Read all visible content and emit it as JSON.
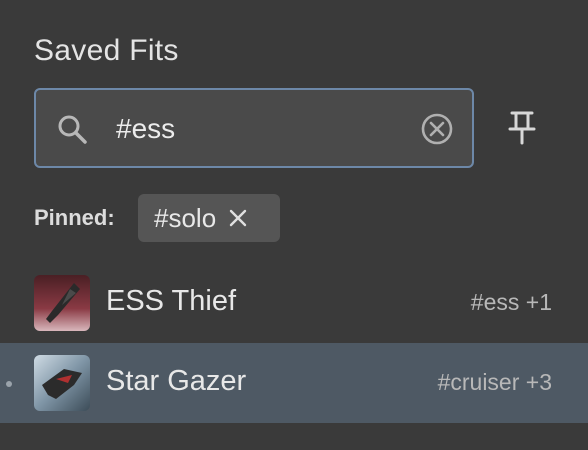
{
  "panel": {
    "title": "Saved Fits"
  },
  "search": {
    "value": "#ess",
    "icon": "search-icon",
    "clear_icon": "clear-circle-icon",
    "border_color": "#6d88a8"
  },
  "pin_button": {
    "icon": "pin-icon"
  },
  "pinned": {
    "label": "Pinned:",
    "chips": [
      {
        "label": "#solo",
        "icon": "close-icon"
      }
    ]
  },
  "fits": [
    {
      "name": "ESS Thief",
      "tags": "#ess +1",
      "selected": false,
      "thumb_color": "#8a3a44"
    },
    {
      "name": "Star Gazer",
      "tags": "#cruiser +3",
      "selected": true,
      "thumb_color": "#9fb4c4"
    }
  ],
  "colors": {
    "background": "#3a3a3a",
    "selected_row": "#4e5964",
    "chip_bg": "#555555"
  }
}
